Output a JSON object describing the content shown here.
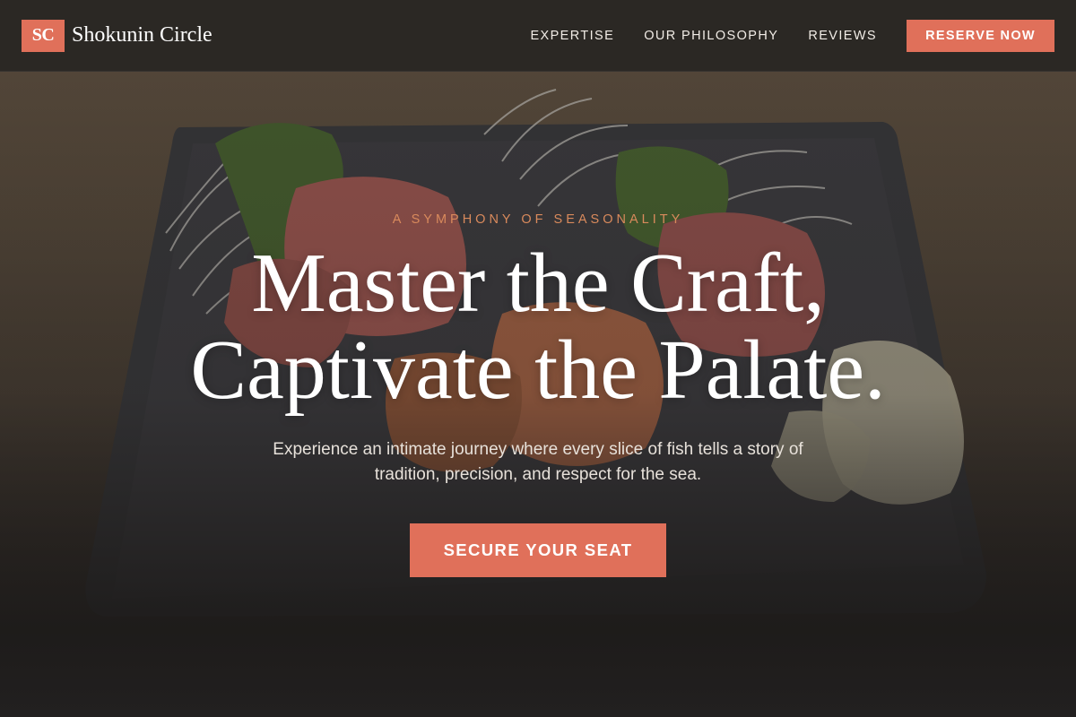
{
  "brand": {
    "badge": "SC",
    "name": "Shokunin Circle"
  },
  "nav": {
    "links": [
      "EXPERTISE",
      "OUR PHILOSOPHY",
      "REVIEWS"
    ],
    "reserve_label": "RESERVE NOW"
  },
  "hero": {
    "eyebrow": "A SYMPHONY OF SEASONALITY",
    "headline_line1": "Master the Craft,",
    "headline_line2": "Captivate the Palate.",
    "subtitle_line1": "Experience an intimate journey where every slice of fish tells a story of",
    "subtitle_line2": "tradition, precision, and respect for the sea.",
    "cta_label": "SECURE YOUR SEAT"
  },
  "colors": {
    "accent": "#e0705a",
    "eyebrow": "#d98a5c",
    "nav_bg": "#2a2623",
    "page_bg": "#232120"
  }
}
